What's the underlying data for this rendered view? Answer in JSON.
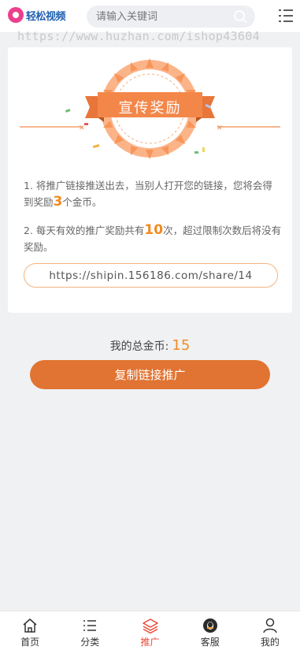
{
  "header": {
    "logo_text": "轻松视频",
    "search_placeholder": "请输入关键词"
  },
  "watermark": "https://www.huzhan.com/ishop43604",
  "banner": {
    "title": "宣传奖励"
  },
  "rules": {
    "rule1_prefix": "1. 将推广链接推送出去，当别人打开您的链接，您将会得到奖励",
    "rule1_number": "3",
    "rule1_suffix": "个金币。",
    "rule2_prefix": "2. 每天有效的推广奖励共有",
    "rule2_number": "10",
    "rule2_suffix": "次，超过限制次数后将没有奖励。"
  },
  "share_link": "https://shipin.156186.com/share/14",
  "coins": {
    "label": "我的总金币:",
    "value": "15"
  },
  "copy_button": "复制链接推广",
  "nav": [
    {
      "label": "首页",
      "icon": "home-icon"
    },
    {
      "label": "分类",
      "icon": "list-icon"
    },
    {
      "label": "推广",
      "icon": "layers-icon",
      "active": true
    },
    {
      "label": "客服",
      "icon": "qq-icon"
    },
    {
      "label": "我的",
      "icon": "user-icon"
    }
  ],
  "colors": {
    "accent": "#e17432",
    "active_nav": "#e8493a",
    "highlight_number": "#f28a1e",
    "logo_blue": "#1e5fae",
    "logo_pink": "#ec3f8c"
  }
}
